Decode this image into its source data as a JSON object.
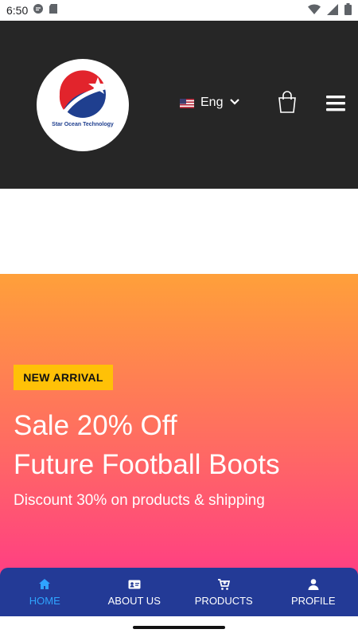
{
  "status_bar": {
    "time": "6:50"
  },
  "header": {
    "logo_text": "Star Ocean Technology",
    "language": "Eng",
    "colors": {
      "background": "#262626",
      "logo_red": "#e2242c",
      "logo_blue": "#1f3f8f"
    }
  },
  "hero": {
    "badge": "NEW ARRIVAL",
    "title_line1": "Sale 20% Off",
    "title_line2": "Future Football Boots",
    "subtitle": "Discount 30% on products & shipping",
    "colors": {
      "gradient_top": "#ffa03a",
      "gradient_bottom": "#ff2a92",
      "badge": "#ffc107"
    }
  },
  "bottom_nav": {
    "items": [
      {
        "label": "HOME",
        "icon": "home-icon",
        "active": true
      },
      {
        "label": "ABOUT US",
        "icon": "id-card-icon",
        "active": false
      },
      {
        "label": "PRODUCTS",
        "icon": "cart-icon",
        "active": false
      },
      {
        "label": "PROFILE",
        "icon": "person-icon",
        "active": false
      }
    ],
    "colors": {
      "background": "#233a96",
      "active": "#2fa4ff"
    }
  }
}
